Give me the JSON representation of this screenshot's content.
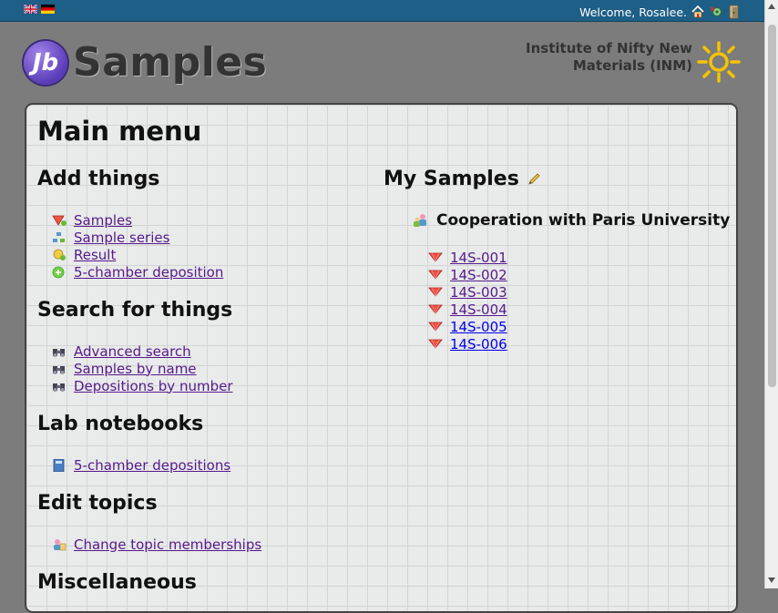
{
  "topbar": {
    "flags": [
      "english-flag",
      "german-flag"
    ],
    "welcome": "Welcome, Rosalee.",
    "icons": [
      "home-icon",
      "settings-icon",
      "logout-icon"
    ]
  },
  "header": {
    "logo_badge": "Jb",
    "logo_text": "Samples",
    "institute_line1": "Institute of Nifty New",
    "institute_line2": "Materials (INM)"
  },
  "main": {
    "title": "Main menu",
    "add_things": {
      "heading": "Add things",
      "items": [
        {
          "label": "Samples",
          "icon": "sample-add-icon"
        },
        {
          "label": "Sample series",
          "icon": "series-add-icon"
        },
        {
          "label": "Result",
          "icon": "result-add-icon"
        },
        {
          "label": "5-chamber deposition",
          "icon": "deposition-add-icon"
        }
      ]
    },
    "search_things": {
      "heading": "Search for things",
      "items": [
        {
          "label": "Advanced search",
          "icon": "binoculars-icon"
        },
        {
          "label": "Samples by name",
          "icon": "binoculars-icon"
        },
        {
          "label": "Depositions by number",
          "icon": "binoculars-icon"
        }
      ]
    },
    "lab_notebooks": {
      "heading": "Lab notebooks",
      "items": [
        {
          "label": "5-chamber depositions",
          "icon": "notebook-icon"
        }
      ]
    },
    "edit_topics": {
      "heading": "Edit topics",
      "items": [
        {
          "label": "Change topic memberships",
          "icon": "topic-icon"
        }
      ]
    },
    "misc": {
      "heading": "Miscellaneous"
    },
    "my_samples": {
      "heading": "My Samples",
      "topic": "Cooperation with Paris University",
      "samples": [
        "14S-001",
        "14S-002",
        "14S-003",
        "14S-004",
        "14S-005",
        "14S-006"
      ]
    }
  },
  "colors": {
    "topbar": "#1d5f86",
    "link_visited": "#551a8b",
    "link": "#0000ee"
  }
}
